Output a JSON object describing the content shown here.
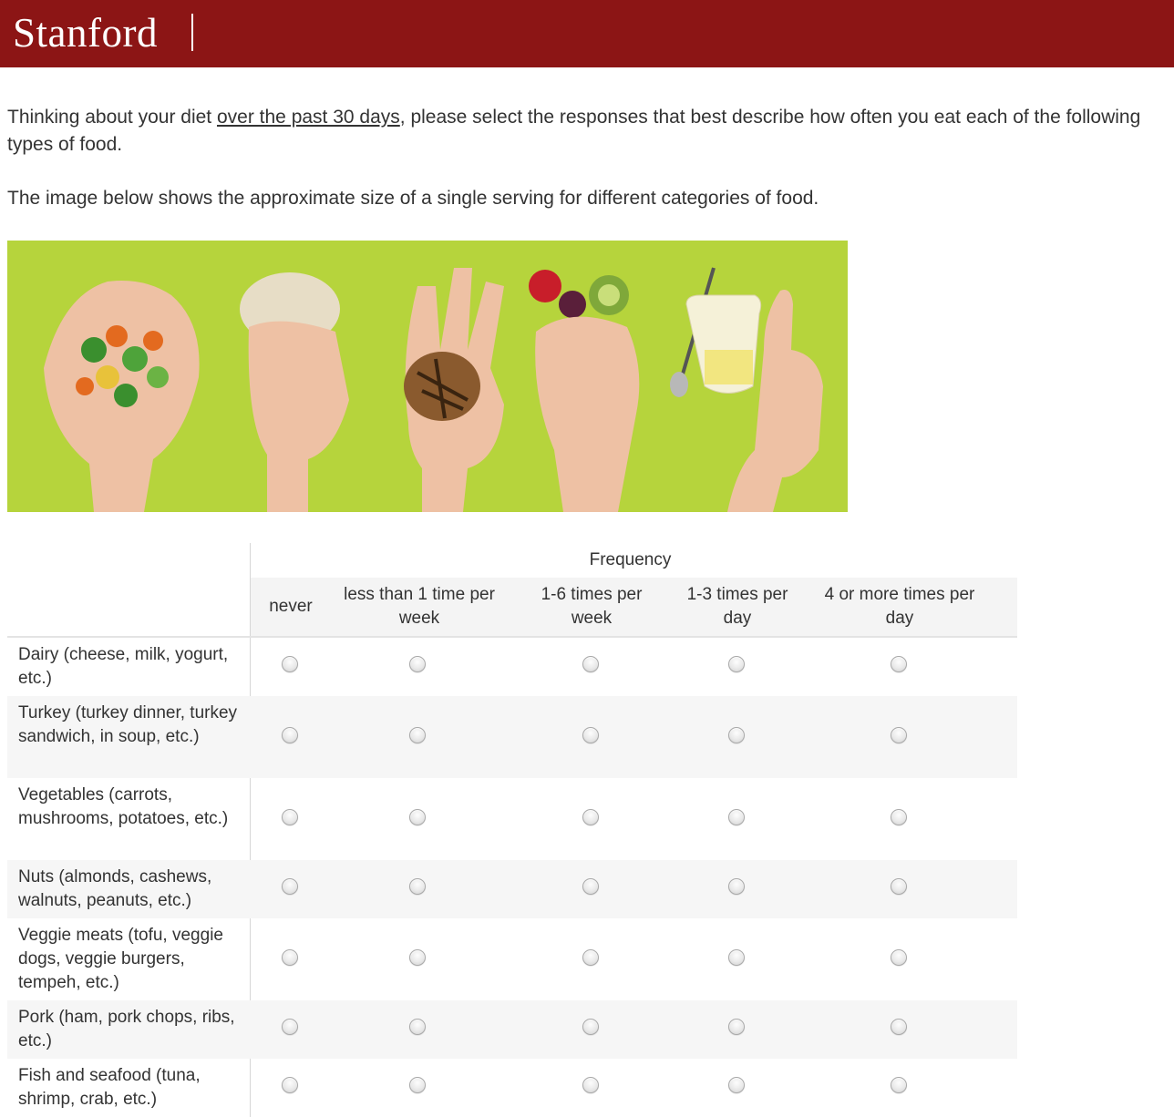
{
  "header": {
    "logo_text": "Stanford",
    "brand_color": "#8c1515"
  },
  "intro": {
    "line1_before": "Thinking about your diet ",
    "line1_link": "over the past 30 days",
    "line1_after": ", please select the responses that best describe how often you eat each of the following types of food.",
    "line2": "The image below shows the approximate size of a single serving for different categories of food."
  },
  "image": {
    "background_color": "#b6d43c"
  },
  "matrix": {
    "group_header": "Frequency",
    "columns": [
      "never",
      "less than 1 time per week",
      "1-6 times per week",
      "1-3 times per day",
      "4 or more times per day"
    ],
    "rows": [
      {
        "label": "Dairy (cheese, milk, yogurt, etc.)"
      },
      {
        "label": "Turkey (turkey dinner, turkey sandwich, in soup, etc.)"
      },
      {
        "label": "Vegetables (carrots, mushrooms, potatoes, etc.)"
      },
      {
        "label": "Nuts (almonds, cashews, walnuts, peanuts, etc.)"
      },
      {
        "label": "Veggie meats (tofu, veggie dogs, veggie burgers, tempeh, etc.)"
      },
      {
        "label": "Pork (ham, pork chops, ribs, etc.)"
      },
      {
        "label": "Fish and seafood (tuna, shrimp, crab, etc.)"
      }
    ]
  }
}
